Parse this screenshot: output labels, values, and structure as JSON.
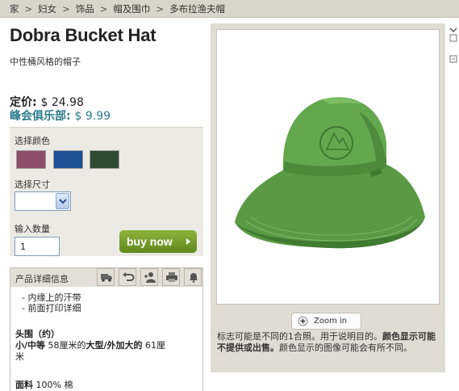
{
  "breadcrumb": [
    "家",
    "妇女",
    "饰品",
    "帽及围巾",
    "多布拉渔夫帽"
  ],
  "breadcrumb_sep": ">",
  "product": {
    "title": "Dobra Bucket Hat",
    "subtitle": "中性桶风格的帽子",
    "price_label": "定价:",
    "price_value": "$ 24.98",
    "club_label": "峰会俱乐部:",
    "club_value": "$ 9.99"
  },
  "options": {
    "color_label": "选择颜色",
    "colors": [
      "#8d4e6a",
      "#1f4f95",
      "#2e4a31"
    ],
    "size_label": "选择尺寸",
    "size_value": "",
    "qty_label": "输入数量",
    "qty_value": "1",
    "buy_label": "buy now"
  },
  "details": {
    "heading": "产品详细信息",
    "tool_icons": [
      "truck-icon",
      "return-icon",
      "person-icon",
      "print-icon",
      "bell-icon"
    ],
    "bullets": [
      "内缘上的汗带",
      "前面打印详细"
    ],
    "size_title": "头围（约）",
    "size_line_1_bold_a": "小/中等",
    "size_line_1_a": " 58厘米的",
    "size_line_1_bold_b": "大型/外加大的",
    "size_line_1_b": " 61厘",
    "size_line_2": "米",
    "material_label": "面料",
    "material_value": " 100% 棉"
  },
  "image": {
    "zoom_label": "Zoom in",
    "caption_a": "标志可能是不同的1合照。用于说明目的。",
    "caption_bold": "颜色显示可能不提供或出售。",
    "caption_b": "颜色显示的图像可能会有所不同。"
  },
  "colors": {
    "hat_main": "#5c9c46",
    "club_price": "#2c7c8c",
    "buy_button": "#6f9a26"
  }
}
